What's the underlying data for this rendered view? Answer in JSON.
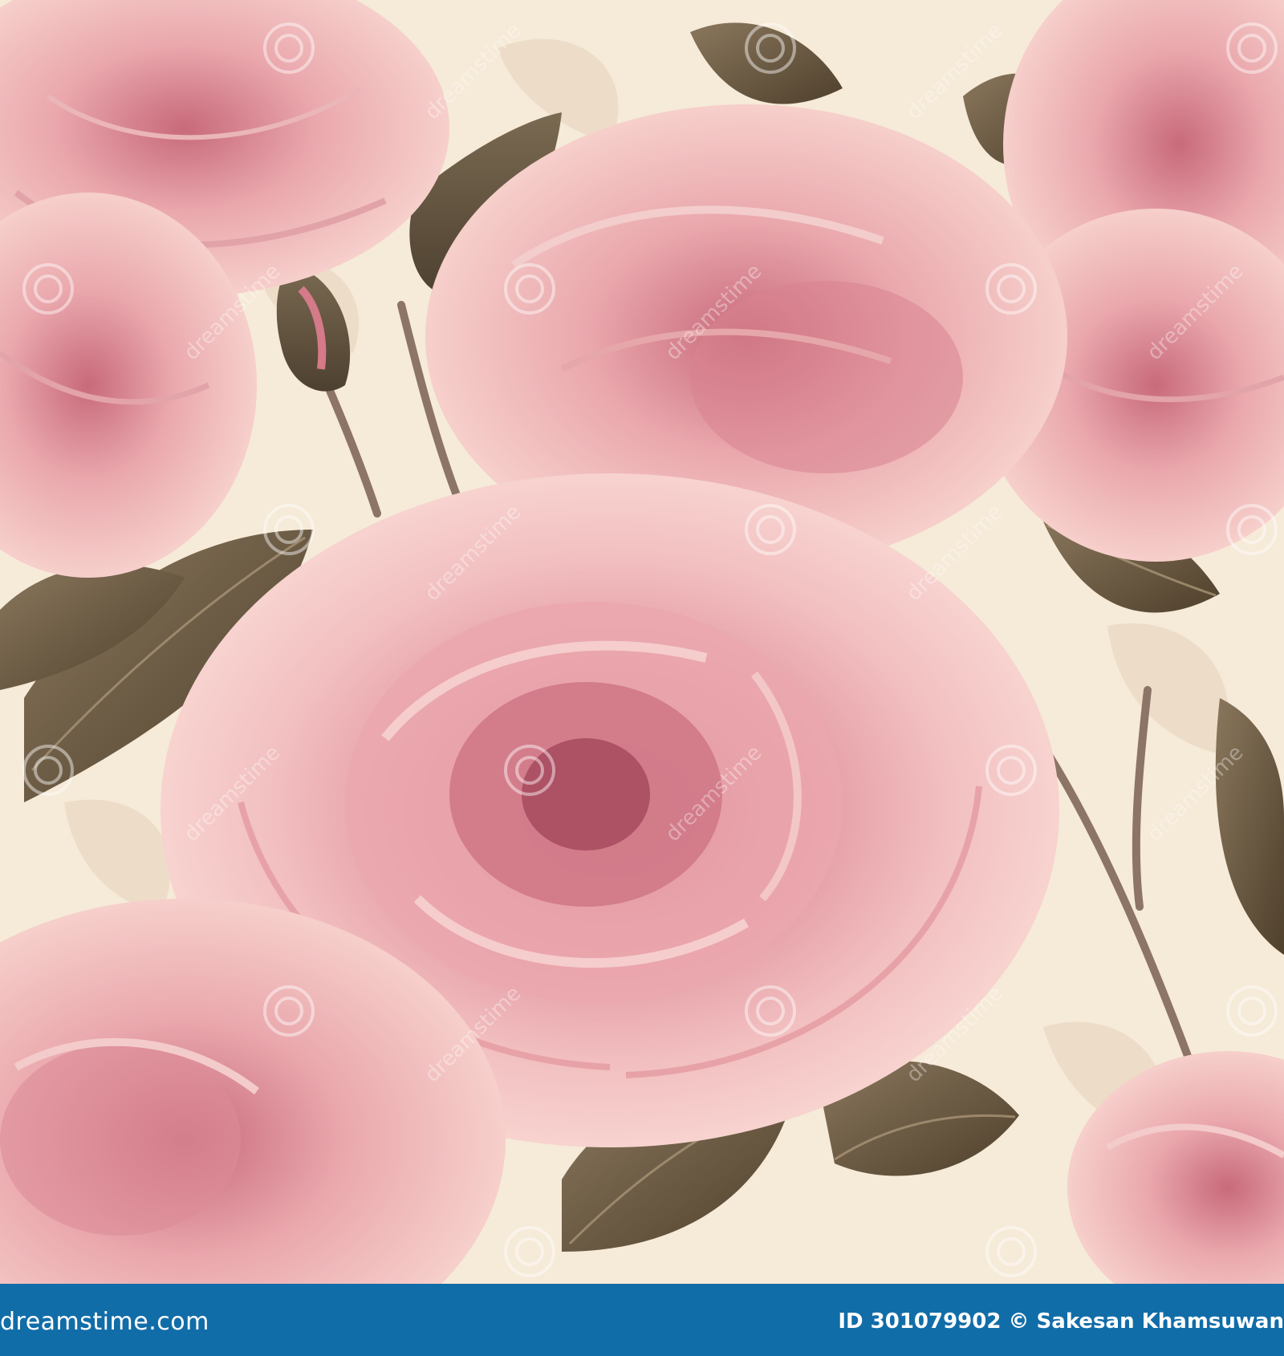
{
  "image": {
    "subject": "seamless-rose-pattern",
    "colors": {
      "background": "#f6ead8",
      "petal_light": "#f3c3c3",
      "petal_mid": "#e59aa0",
      "petal_deep": "#c56674",
      "leaf_dark": "#5b4a35",
      "leaf_light": "#87745a",
      "stem": "#8c7466"
    }
  },
  "watermark": {
    "text": "dreamstime",
    "icon": "dreamstime-swirl-icon"
  },
  "footer": {
    "background_color": "#116da8",
    "brand_text": "dreamstime.com",
    "credit_text": "ID 301079902 © Sakesan Khamsuwan"
  }
}
